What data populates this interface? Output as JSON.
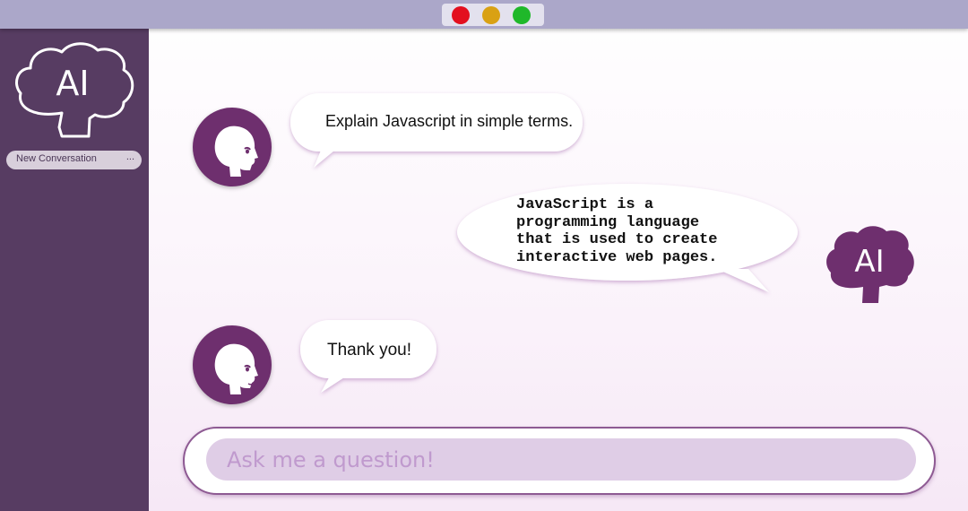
{
  "window": {
    "controls": {
      "close_color": "#e3101f",
      "minimize_color": "#d9a114",
      "maximize_color": "#1fb82a"
    }
  },
  "sidebar": {
    "logo_text": "AI",
    "new_conversation_label": "New Conversation",
    "menu_label": "..."
  },
  "conversation": {
    "messages": [
      {
        "sender": "user",
        "text": "Explain Javascript in simple terms."
      },
      {
        "sender": "ai",
        "text": "JavaScript is a\nprogramming language\nthat is used to create\ninteractive web pages."
      },
      {
        "sender": "user",
        "text": "Thank you!"
      }
    ],
    "ai_avatar_text": "AI"
  },
  "input": {
    "placeholder": "Ask me a question!",
    "value": ""
  },
  "colors": {
    "sidebar": "#573c62",
    "titlebar": "#aba7c9",
    "avatar": "#6e2f6e",
    "input_fill": "#dfcde6",
    "placeholder": "#c09ace"
  },
  "icons": [
    "brain-cloud-ai-logo-icon",
    "user-head-icon",
    "ai-bot-icon"
  ]
}
